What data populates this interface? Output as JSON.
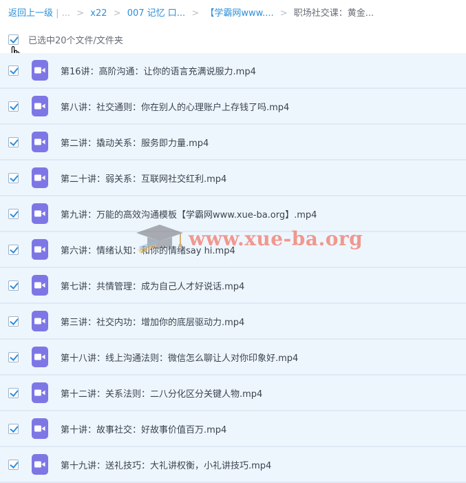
{
  "breadcrumb": {
    "back": "返回上一级",
    "ellipsis": "| ...",
    "sep": ">",
    "items": [
      "x22",
      "007 记忆 口...",
      "【学霸网www....",
      "职场社交课：黄金..."
    ]
  },
  "selection": {
    "text": "已选中20个文件/文件夹",
    "checked": true
  },
  "watermark": {
    "text": "www.xue-ba.org"
  },
  "colors": {
    "link": "#2b8fd9",
    "row_bg": "#eef6fd",
    "video_icon": "#7d77e6",
    "check": "#2f8fdc"
  },
  "files": [
    {
      "name": "第16讲：高阶沟通：让你的语言充满说服力.mp4",
      "checked": true,
      "icon": "video-file-icon"
    },
    {
      "name": "第八讲：社交通则：你在别人的心理账户上存钱了吗.mp4",
      "checked": true,
      "icon": "video-file-icon"
    },
    {
      "name": "第二讲：撬动关系：服务即力量.mp4",
      "checked": true,
      "icon": "video-file-icon"
    },
    {
      "name": "第二十讲：弱关系：互联网社交红利.mp4",
      "checked": true,
      "icon": "video-file-icon"
    },
    {
      "name": "第九讲：万能的高效沟通模板【学霸网www.xue-ba.org】.mp4",
      "checked": true,
      "icon": "video-file-icon"
    },
    {
      "name": "第六讲：情绪认知：和你的情绪say hi.mp4",
      "checked": true,
      "icon": "video-file-icon"
    },
    {
      "name": "第七讲：共情管理：成为自己人才好说话.mp4",
      "checked": true,
      "icon": "video-file-icon"
    },
    {
      "name": "第三讲：社交内功：增加你的底层驱动力.mp4",
      "checked": true,
      "icon": "video-file-icon"
    },
    {
      "name": "第十八讲：线上沟通法则：微信怎么聊让人对你印象好.mp4",
      "checked": true,
      "icon": "video-file-icon"
    },
    {
      "name": "第十二讲：关系法则：二八分化区分关键人物.mp4",
      "checked": true,
      "icon": "video-file-icon"
    },
    {
      "name": "第十讲：故事社交：好故事价值百万.mp4",
      "checked": true,
      "icon": "video-file-icon"
    },
    {
      "name": "第十九讲：送礼技巧：大礼讲权衡，小礼讲技巧.mp4",
      "checked": true,
      "icon": "video-file-icon"
    }
  ]
}
